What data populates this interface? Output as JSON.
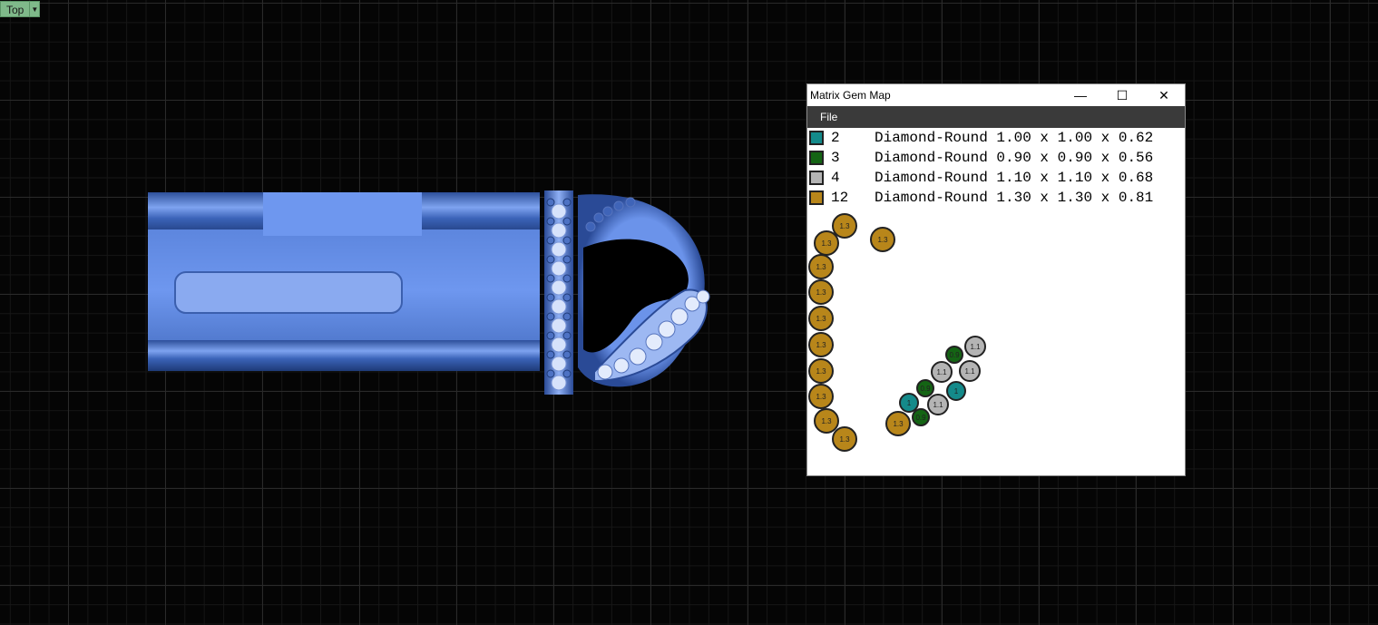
{
  "viewport": {
    "label": "Top"
  },
  "gem_window": {
    "title": "Matrix Gem Map",
    "controls": {
      "minimize": "—",
      "maximize": "☐",
      "close": "✕"
    },
    "menu": [
      "File"
    ],
    "legend": [
      {
        "color": "#148a8a",
        "count": "2",
        "description": "Diamond-Round 1.00 x 1.00 x 0.62"
      },
      {
        "color": "#146414",
        "count": "3",
        "description": "Diamond-Round 0.90 x 0.90 x 0.56"
      },
      {
        "color": "#b4b4b4",
        "count": "4",
        "description": "Diamond-Round 1.10 x 1.10 x 0.68"
      },
      {
        "color": "#b8861a",
        "count": "12",
        "description": "Diamond-Round 1.30 x 1.30 x 0.81"
      }
    ],
    "gems": [
      {
        "size": "1.3",
        "color": "#b8861a"
      },
      {
        "size": "1.3",
        "color": "#b8861a"
      },
      {
        "size": "1.3",
        "color": "#b8861a"
      },
      {
        "size": "1.3",
        "color": "#b8861a"
      },
      {
        "size": "1.3",
        "color": "#b8861a"
      },
      {
        "size": "1.3",
        "color": "#b8861a"
      },
      {
        "size": "1.3",
        "color": "#b8861a"
      },
      {
        "size": "1.3",
        "color": "#b8861a"
      },
      {
        "size": "1.3",
        "color": "#b8861a"
      },
      {
        "size": "1.3",
        "color": "#b8861a"
      },
      {
        "size": "1.3",
        "color": "#b8861a"
      },
      {
        "size": "1.3",
        "color": "#b8861a"
      },
      {
        "size": "1.1",
        "color": "#b4b4b4"
      },
      {
        "size": "1.1",
        "color": "#b4b4b4"
      },
      {
        "size": "1.1",
        "color": "#b4b4b4"
      },
      {
        "size": "1.1",
        "color": "#b4b4b4"
      },
      {
        "size": "0.9",
        "color": "#146414"
      },
      {
        "size": "0.9",
        "color": "#146414"
      },
      {
        "size": "0.9",
        "color": "#146414"
      },
      {
        "size": "1",
        "color": "#148a8a"
      },
      {
        "size": "1",
        "color": "#148a8a"
      }
    ]
  }
}
